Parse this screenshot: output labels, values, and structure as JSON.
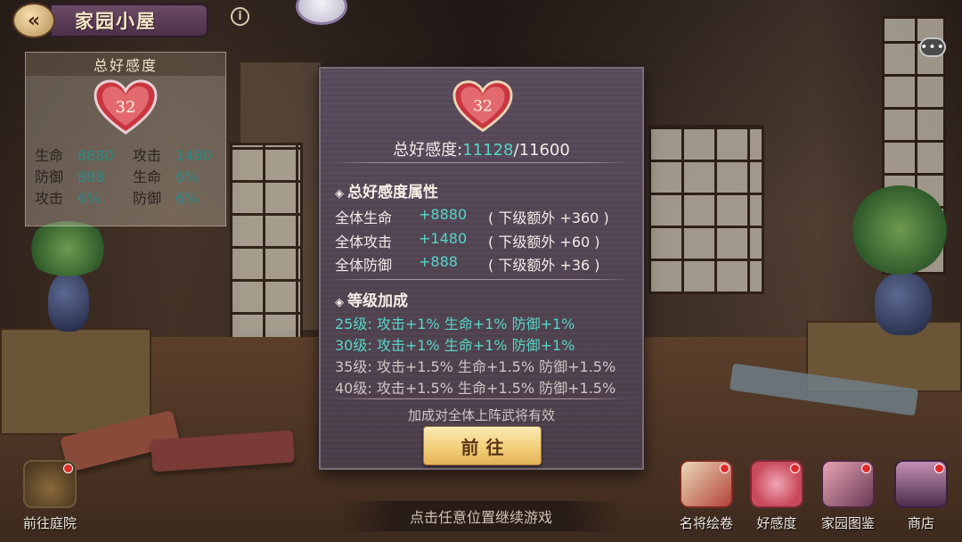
{
  "header": {
    "back_icon": "back-arrow-icon",
    "title": "家园小屋",
    "info_icon_glyph": "i",
    "chat_icon_glyph": "•••"
  },
  "left_panel": {
    "title": "总好感度",
    "level": "32",
    "stats": [
      {
        "label": "生命",
        "value": "8880"
      },
      {
        "label": "攻击",
        "value": "1480"
      },
      {
        "label": "防御",
        "value": "888"
      },
      {
        "label": "生命",
        "value": "6%"
      },
      {
        "label": "攻击",
        "value": "6%"
      },
      {
        "label": "防御",
        "value": "6%"
      }
    ]
  },
  "dialog": {
    "level": "32",
    "total_label": "总好感度:",
    "total_current": "11128",
    "total_max": "/11600",
    "attr_section_title": "总好感度属性",
    "attrs": [
      {
        "name": "全体生命",
        "value": "+8880",
        "extra": "( 下级额外 +360 )"
      },
      {
        "name": "全体攻击",
        "value": "+1480",
        "extra": "( 下级额外 +60 )"
      },
      {
        "name": "全体防御",
        "value": "+888",
        "extra": "( 下级额外 +36 )"
      }
    ],
    "level_section_title": "等级加成",
    "level_bonuses": [
      {
        "text": "25级: 攻击+1% 生命+1% 防御+1%",
        "active": true
      },
      {
        "text": "30级: 攻击+1% 生命+1% 防御+1%",
        "active": true
      },
      {
        "text": "35级: 攻击+1.5% 生命+1.5% 防御+1.5%",
        "active": false
      },
      {
        "text": "40级: 攻击+1.5% 生命+1.5% 防御+1.5%",
        "active": false
      }
    ],
    "note": "加成对全体上阵武将有效",
    "go_button": "前往"
  },
  "footer": {
    "continue_text": "点击任意位置继续游戏",
    "buttons": [
      {
        "label": "前往庭院",
        "icon": "courtyard-icon",
        "red_dot": true
      },
      {
        "label": "名将绘卷",
        "icon": "scroll-icon",
        "red_dot": true
      },
      {
        "label": "好感度",
        "icon": "affinity-gift-icon",
        "red_dot": true
      },
      {
        "label": "家园图鉴",
        "icon": "album-icon",
        "red_dot": true
      },
      {
        "label": "商店",
        "icon": "shop-icon",
        "red_dot": true
      }
    ]
  },
  "colors": {
    "accent_teal": "#56d6c8",
    "button_gold": "#f2cf7a",
    "dialog_bg": "#4a3c47"
  }
}
